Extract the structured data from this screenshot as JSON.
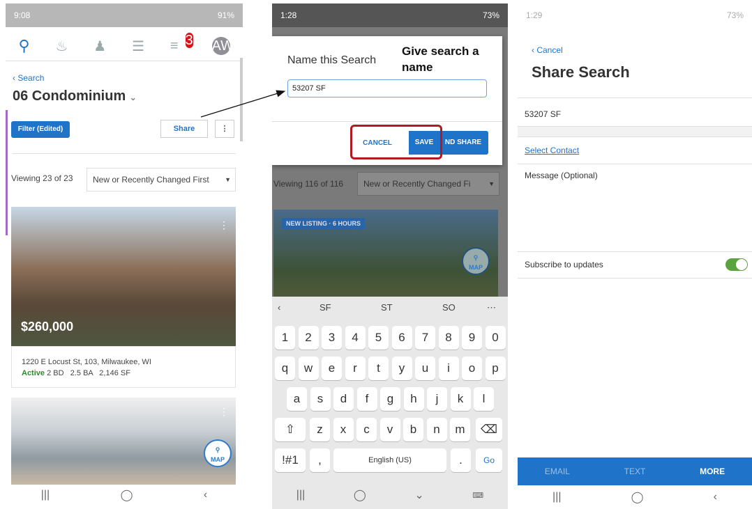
{
  "phone1": {
    "status_time": "9:08",
    "status_right": "91%",
    "notification_count": "3",
    "avatar_initials": "AW",
    "back_label": "Search",
    "title": "06 Condominium",
    "filter_label": "Filter (Edited)",
    "share_label": "Share",
    "viewing_text": "Viewing 23 of 23",
    "sort_value": "New or Recently Changed First",
    "listing": {
      "price": "$260,000",
      "address": "1220 E Locust St, 103, Milwaukee, WI",
      "status": "Active",
      "details": "2 BD   2.5 BA   2,146 SF"
    },
    "map_label": "MAP"
  },
  "phone2": {
    "status_time": "1:28",
    "status_right": "73%",
    "dialog_title": "Name this Search",
    "annotation": "Give search a name",
    "name_input_value": "53207 SF",
    "cancel_label": "CANCEL",
    "save_label": "SAVE",
    "save_share_label": "ND SHARE",
    "viewing_text": "Viewing 116 of 116",
    "sort_value": "New or Recently Changed Fi",
    "listing_badge": "NEW LISTING · 6 HOURS",
    "map_label": "MAP",
    "suggestions": [
      "SF",
      "ST",
      "SO"
    ],
    "keys_numbers": [
      "1",
      "2",
      "3",
      "4",
      "5",
      "6",
      "7",
      "8",
      "9",
      "0"
    ],
    "keys_row1": [
      "q",
      "w",
      "e",
      "r",
      "t",
      "y",
      "u",
      "i",
      "o",
      "p"
    ],
    "keys_row2": [
      "a",
      "s",
      "d",
      "f",
      "g",
      "h",
      "j",
      "k",
      "l"
    ],
    "keys_row3": [
      "z",
      "x",
      "c",
      "v",
      "b",
      "n",
      "m"
    ],
    "sym_key": "!#1",
    "comma_key": ",",
    "space_key": "English (US)",
    "period_key": ".",
    "go_key": "Go"
  },
  "phone3": {
    "status_time": "1:29",
    "status_right": "73%",
    "cancel_label": "Cancel",
    "title": "Share Search",
    "search_name": "53207 SF",
    "select_contact": "Select Contact",
    "message_placeholder": "Message (Optional)",
    "subscribe_label": "Subscribe to updates",
    "subscribe_on": true,
    "share_tabs": [
      "EMAIL",
      "TEXT",
      "MORE"
    ]
  },
  "colors": {
    "brand_blue": "#1f73c9",
    "annotation_red": "#b41820",
    "active_green": "#2e8b2e"
  }
}
